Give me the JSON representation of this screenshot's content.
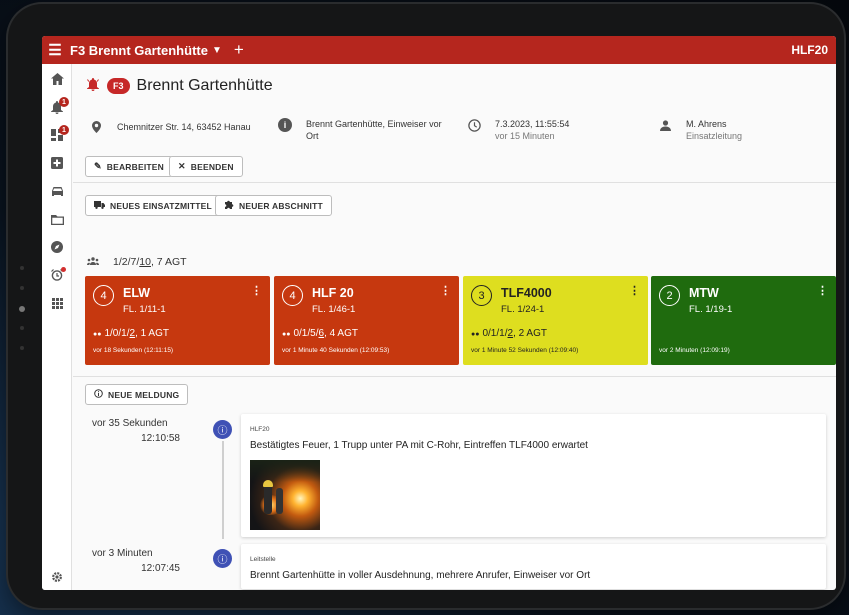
{
  "topbar": {
    "title": "F3 Brennt Gartenhütte",
    "unit": "HLF20"
  },
  "sidebar": {
    "badges": {
      "alarm": "1",
      "overview": "1"
    }
  },
  "incident": {
    "badge": "F3",
    "title": "Brennt Gartenhütte",
    "address": "Chemnitzer Str. 14, 63452 Hanau",
    "info": "Brennt Gartenhütte, Einweiser vor Ort",
    "datetime": "7.3.2023, 11:55:54",
    "datetime_relative": "vor 15 Minuten",
    "leader_name": "M. Ahrens",
    "leader_role": "Einsatzleitung"
  },
  "actions": {
    "edit": "BEARBEITEN",
    "end": "BEENDEN",
    "new_unit": "NEUES EINSATZMITTEL",
    "new_section": "NEUER ABSCHNITT",
    "new_message": "NEUE MELDUNG"
  },
  "strength": {
    "prefix": "1/2/7/",
    "underlined": "10",
    "suffix": ", 7 AGT"
  },
  "units": [
    {
      "num": "4",
      "name": "ELW",
      "fl": "FL. 1/11-1",
      "s_prefix": "1/0/1/",
      "s_ul": "2",
      "s_suffix": ", 1 AGT",
      "time": "vor 18 Sekunden (12:11:15)",
      "color": "#c6380f",
      "text": "#ffffff"
    },
    {
      "num": "4",
      "name": "HLF 20",
      "fl": "FL. 1/46-1",
      "s_prefix": "0/1/5/",
      "s_ul": "6",
      "s_suffix": ", 4 AGT",
      "time": "vor 1 Minute 40 Sekunden (12:09:53)",
      "color": "#c6380f",
      "text": "#ffffff"
    },
    {
      "num": "3",
      "name": "TLF4000",
      "fl": "FL. 1/24-1",
      "s_prefix": "0/1/1/",
      "s_ul": "2",
      "s_suffix": ", 2 AGT",
      "time": "vor 1 Minute 52 Sekunden (12:09:40)",
      "color": "#dede1f",
      "text": "#222222"
    },
    {
      "num": "2",
      "name": "MTW",
      "fl": "FL. 1/19-1",
      "s_prefix": "",
      "s_ul": "",
      "s_suffix": "",
      "time": "vor 2 Minuten (12:09:19)",
      "color": "#1f6b0e",
      "text": "#ffffff"
    }
  ],
  "timeline": [
    {
      "ago": "vor 35 Sekunden",
      "time": "12:10:58",
      "who": "HLF20",
      "message": "Bestätigtes Feuer, 1 Trupp unter PA mit C-Rohr, Eintreffen TLF4000 erwartet"
    },
    {
      "ago": "vor 3 Minuten",
      "time": "12:07:45",
      "who": "Leitstelle",
      "message": "Brennt Gartenhütte in voller Ausdehnung, mehrere Anrufer, Einweiser vor Ort"
    }
  ]
}
